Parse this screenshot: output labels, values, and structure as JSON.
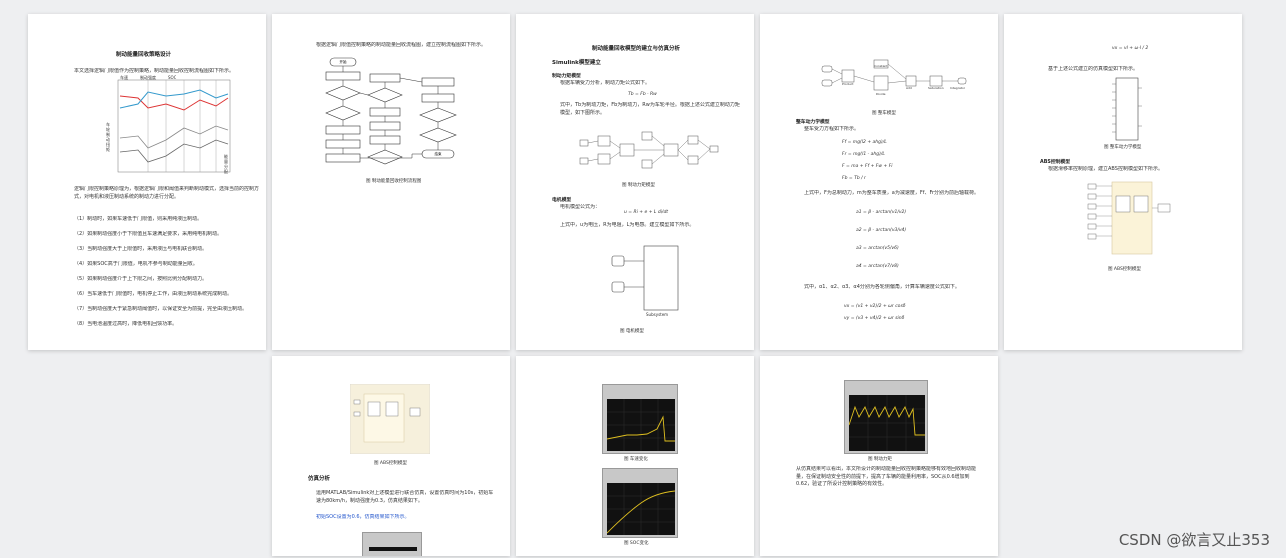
{
  "page1": {
    "title": "制动能量回收策略设计",
    "intro": "本文选择逻辑门限值作为控制策略，制动能量回收控制流程图如下所示。",
    "legend_labels": [
      "车速",
      "制动强度",
      "SOC"
    ],
    "y_labels": [
      "车",
      "轮",
      "制",
      "动",
      "扭",
      "矩"
    ],
    "side_labels": [
      "能",
      "量",
      "分",
      "配"
    ],
    "para1": "逻辑门限控制策略原理为，根据逻辑门限和阈值来判断制动模式，选择当前的控制方式，对电机和液压制动系统的制动力进行分配。",
    "items": [
      "（1）制动时，如果车速低于门限值，则采用纯液压制动。",
      "（2）如果制动强度小于下限值且车速满足要求，采用纯电机制动。",
      "（3）当制动强度大于上限值时，采用液压与电机联合制动。",
      "（4）如果SOC高于门限值，电机不参与制动能量回收。",
      "（5）如果制动强度介于上下限之间，按照比例分配制动力。",
      "（6）当车速低于门限值时，电机停止工作，由液压制动系统完成制动。",
      "（7）当制动强度大于紧急制动阈值时，以保证安全为前提，完全由液压制动。",
      "（8）当电池温度过高时，降低电机回馈功率。",
      "（9）当制动强度小于某一门限值时，仅采用电机再生制动。"
    ]
  },
  "page2": {
    "intro": "根据逻辑门限值控制策略的制动能量回收流程图，建立控制流程图如下所示。",
    "caption": "图 制动能量回收控制流程图",
    "start": "开始",
    "end": "结束"
  },
  "page3": {
    "title": "制动能量回收模型的建立与仿真分析",
    "section1": "Simulink模型建立",
    "sub1": "制动力矩模型",
    "sub1_text": "根据车辆受力分析，制动力矩公式如下。",
    "eq1": "Tb = Fb · Rw",
    "sub1_text2": "式中，Tb为制动力矩，Fb为制动力，Rw为车轮半径。根据上述公式建立制动力矩模型，如下图所示。",
    "fig1_cap": "图 制动力矩模型",
    "sub2": "电机模型",
    "sub2_text": "电机模型公式为：",
    "eq2": "u = Ri + e + L di/dt",
    "sub2_text2": "上式中，u为电压，R为电阻，L为电感。建立模型如下所示。",
    "fig2_cap": "图 电机模型"
  },
  "page4": {
    "block_labels": [
      "Constant",
      "Product",
      "Divide",
      "Add",
      "Saturation",
      "Integrator"
    ],
    "fig_cap": "图 整车模型",
    "sub": "整车动力学模型",
    "sub_text": "整车受力方程如下所示。",
    "equations": [
      "Ff = mg(l2 + ahg)/L",
      "Fr = mg(l1 - ahg)/L",
      "F = ma + Ff + Fw + Fi",
      "Fb = Tb / r"
    ],
    "para": "上式中，F为总制动力，m为整车质量，a为减速度，Ff、Fr分别为前后轴载荷。",
    "equations2": [
      "a1 = β - arctan(v1/v2)",
      "a2 = β - arctan(v3/v4)",
      "a3 = arctan(v5/v6)",
      "a4 = arctan(v7/v8)"
    ],
    "para2": "式中，α1、α2、α3、α4分别为各轮侧偏角，计算车辆速度公式如下。",
    "equations3": [
      "vx = (v1 + v2)/2 + ωr cosδ",
      "vy = (v3 + v4)/2 + ωr sinδ"
    ]
  },
  "page5": {
    "eq_top": "vx = vl + ω·l / 2",
    "intro": "基于上述公式建立的仿真模型如下所示。",
    "fig1_cap": "图 整车动力学模型",
    "sub": "ABS控制模型",
    "sub_text": "根据滑移率控制原理，建立ABS控制模型如下所示。",
    "fig2_cap": "图 ABS控制模型"
  },
  "page6": {
    "fig_cap": "图 ABS控制模型",
    "section": "仿真分析",
    "para": "运用MATLAB/Simulink对上述模型进行联合仿真，设置仿真时间为10s，初始车速为80km/h，制动强度为0.3，仿真结果如下。",
    "para2": "初始SOC设置为0.6，仿真结果如下所示。"
  },
  "page7": {
    "fig1_cap": "图 车速变化",
    "fig2_cap": "图 SOC变化"
  },
  "page8": {
    "fig_cap": "图 制动力矩",
    "para": "从仿真结果可以看出，本文所设计的制动能量回收控制策略能够有效地回收制动能量，在保证制动安全性的前提下，提高了车辆的能量利用率，SOC从0.6增加到0.62，验证了所设计控制策略的有效性。"
  },
  "watermark": "CSDN @欲言又止353",
  "colors": {
    "background": "#eeeff1",
    "page": "#ffffff",
    "plot_bg": "#111111",
    "plot_line": "#e0c020"
  }
}
